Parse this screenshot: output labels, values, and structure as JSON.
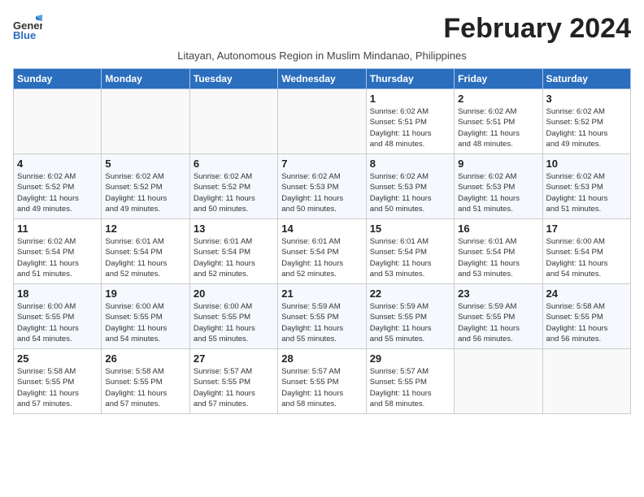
{
  "logo": {
    "general": "General",
    "blue": "Blue"
  },
  "title": "February 2024",
  "subtitle": "Litayan, Autonomous Region in Muslim Mindanao, Philippines",
  "days_header": [
    "Sunday",
    "Monday",
    "Tuesday",
    "Wednesday",
    "Thursday",
    "Friday",
    "Saturday"
  ],
  "weeks": [
    [
      {
        "day": "",
        "info": ""
      },
      {
        "day": "",
        "info": ""
      },
      {
        "day": "",
        "info": ""
      },
      {
        "day": "",
        "info": ""
      },
      {
        "day": "1",
        "info": "Sunrise: 6:02 AM\nSunset: 5:51 PM\nDaylight: 11 hours\nand 48 minutes."
      },
      {
        "day": "2",
        "info": "Sunrise: 6:02 AM\nSunset: 5:51 PM\nDaylight: 11 hours\nand 48 minutes."
      },
      {
        "day": "3",
        "info": "Sunrise: 6:02 AM\nSunset: 5:52 PM\nDaylight: 11 hours\nand 49 minutes."
      }
    ],
    [
      {
        "day": "4",
        "info": "Sunrise: 6:02 AM\nSunset: 5:52 PM\nDaylight: 11 hours\nand 49 minutes."
      },
      {
        "day": "5",
        "info": "Sunrise: 6:02 AM\nSunset: 5:52 PM\nDaylight: 11 hours\nand 49 minutes."
      },
      {
        "day": "6",
        "info": "Sunrise: 6:02 AM\nSunset: 5:52 PM\nDaylight: 11 hours\nand 50 minutes."
      },
      {
        "day": "7",
        "info": "Sunrise: 6:02 AM\nSunset: 5:53 PM\nDaylight: 11 hours\nand 50 minutes."
      },
      {
        "day": "8",
        "info": "Sunrise: 6:02 AM\nSunset: 5:53 PM\nDaylight: 11 hours\nand 50 minutes."
      },
      {
        "day": "9",
        "info": "Sunrise: 6:02 AM\nSunset: 5:53 PM\nDaylight: 11 hours\nand 51 minutes."
      },
      {
        "day": "10",
        "info": "Sunrise: 6:02 AM\nSunset: 5:53 PM\nDaylight: 11 hours\nand 51 minutes."
      }
    ],
    [
      {
        "day": "11",
        "info": "Sunrise: 6:02 AM\nSunset: 5:54 PM\nDaylight: 11 hours\nand 51 minutes."
      },
      {
        "day": "12",
        "info": "Sunrise: 6:01 AM\nSunset: 5:54 PM\nDaylight: 11 hours\nand 52 minutes."
      },
      {
        "day": "13",
        "info": "Sunrise: 6:01 AM\nSunset: 5:54 PM\nDaylight: 11 hours\nand 52 minutes."
      },
      {
        "day": "14",
        "info": "Sunrise: 6:01 AM\nSunset: 5:54 PM\nDaylight: 11 hours\nand 52 minutes."
      },
      {
        "day": "15",
        "info": "Sunrise: 6:01 AM\nSunset: 5:54 PM\nDaylight: 11 hours\nand 53 minutes."
      },
      {
        "day": "16",
        "info": "Sunrise: 6:01 AM\nSunset: 5:54 PM\nDaylight: 11 hours\nand 53 minutes."
      },
      {
        "day": "17",
        "info": "Sunrise: 6:00 AM\nSunset: 5:54 PM\nDaylight: 11 hours\nand 54 minutes."
      }
    ],
    [
      {
        "day": "18",
        "info": "Sunrise: 6:00 AM\nSunset: 5:55 PM\nDaylight: 11 hours\nand 54 minutes."
      },
      {
        "day": "19",
        "info": "Sunrise: 6:00 AM\nSunset: 5:55 PM\nDaylight: 11 hours\nand 54 minutes."
      },
      {
        "day": "20",
        "info": "Sunrise: 6:00 AM\nSunset: 5:55 PM\nDaylight: 11 hours\nand 55 minutes."
      },
      {
        "day": "21",
        "info": "Sunrise: 5:59 AM\nSunset: 5:55 PM\nDaylight: 11 hours\nand 55 minutes."
      },
      {
        "day": "22",
        "info": "Sunrise: 5:59 AM\nSunset: 5:55 PM\nDaylight: 11 hours\nand 55 minutes."
      },
      {
        "day": "23",
        "info": "Sunrise: 5:59 AM\nSunset: 5:55 PM\nDaylight: 11 hours\nand 56 minutes."
      },
      {
        "day": "24",
        "info": "Sunrise: 5:58 AM\nSunset: 5:55 PM\nDaylight: 11 hours\nand 56 minutes."
      }
    ],
    [
      {
        "day": "25",
        "info": "Sunrise: 5:58 AM\nSunset: 5:55 PM\nDaylight: 11 hours\nand 57 minutes."
      },
      {
        "day": "26",
        "info": "Sunrise: 5:58 AM\nSunset: 5:55 PM\nDaylight: 11 hours\nand 57 minutes."
      },
      {
        "day": "27",
        "info": "Sunrise: 5:57 AM\nSunset: 5:55 PM\nDaylight: 11 hours\nand 57 minutes."
      },
      {
        "day": "28",
        "info": "Sunrise: 5:57 AM\nSunset: 5:55 PM\nDaylight: 11 hours\nand 58 minutes."
      },
      {
        "day": "29",
        "info": "Sunrise: 5:57 AM\nSunset: 5:55 PM\nDaylight: 11 hours\nand 58 minutes."
      },
      {
        "day": "",
        "info": ""
      },
      {
        "day": "",
        "info": ""
      }
    ]
  ]
}
